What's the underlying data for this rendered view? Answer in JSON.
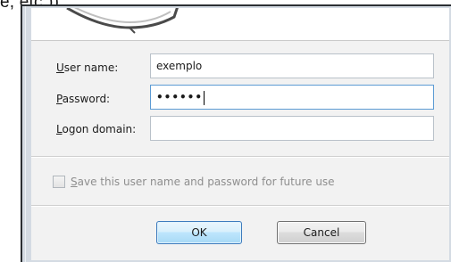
{
  "header": {
    "caption": "e, etc.))"
  },
  "form": {
    "username": {
      "label_mnemonic": "U",
      "label_rest": "ser name:",
      "value": "exemplo"
    },
    "password": {
      "label_mnemonic": "P",
      "label_rest": "assword:",
      "value_masked": "••••••"
    },
    "domain": {
      "label_mnemonic": "L",
      "label_rest": "ogon domain:",
      "value": ""
    }
  },
  "remember": {
    "checked": false,
    "label_mnemonic": "S",
    "label_rest": "ave this user name and password for future use"
  },
  "buttons": {
    "ok_label": "OK",
    "cancel_label": "Cancel"
  },
  "colors": {
    "focus_border": "#5c9bd4",
    "ok_border": "#3d7bbd",
    "disabled_text": "#8e8e8e"
  },
  "icons": {
    "banner": "keys-icon"
  }
}
